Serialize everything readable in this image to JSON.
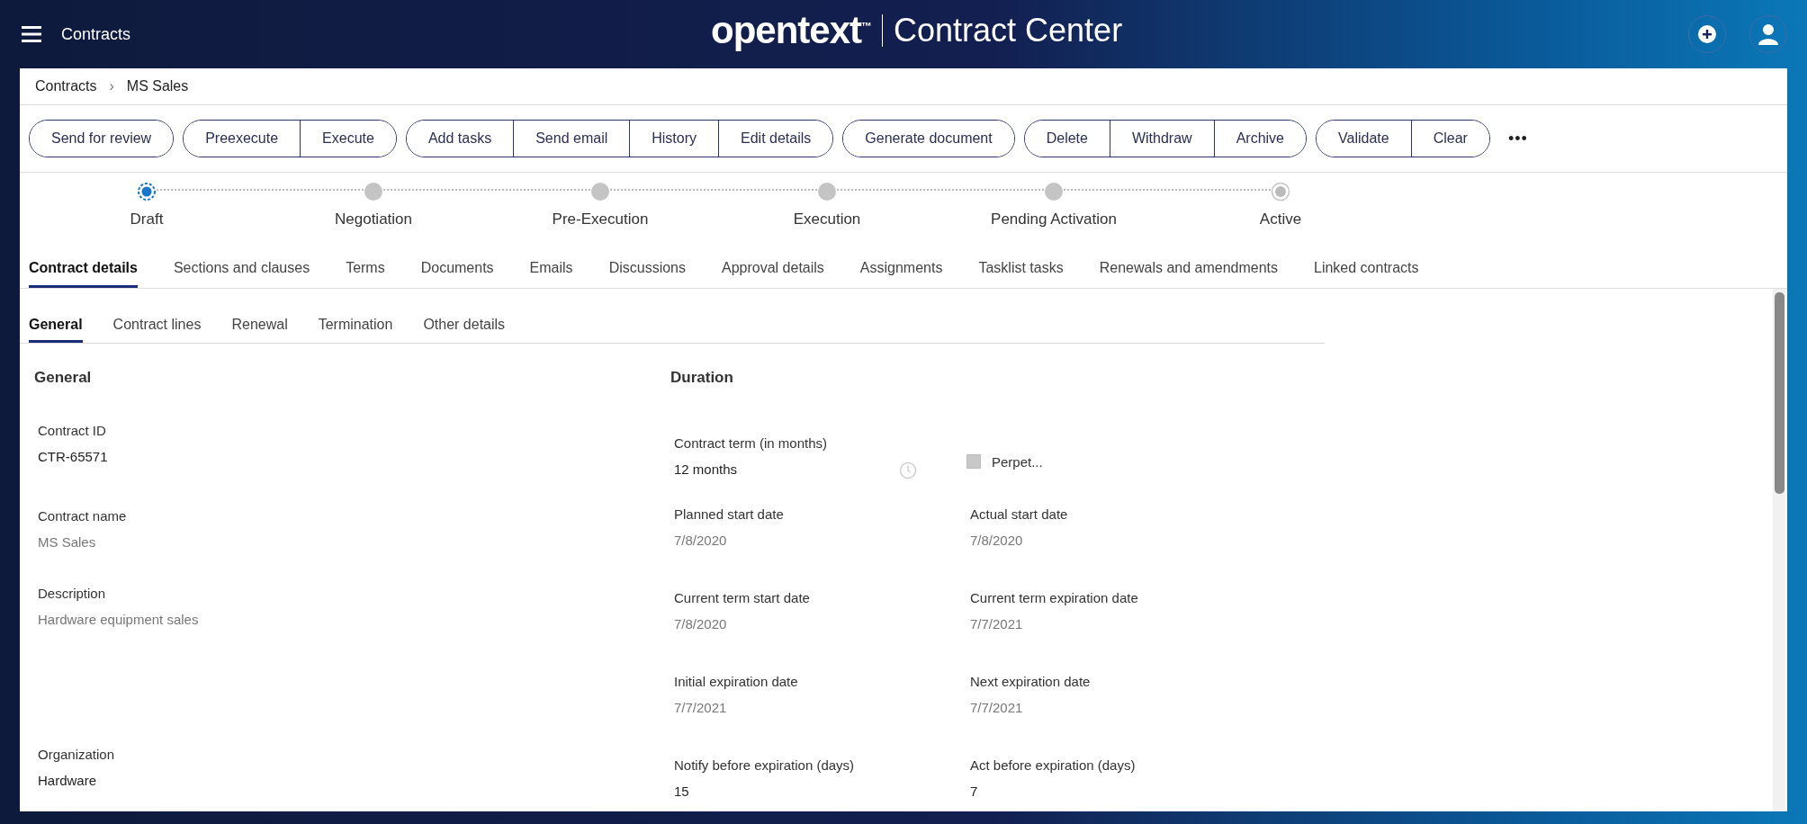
{
  "header": {
    "title": "Contracts",
    "logo": "opentext$^{™}$",
    "product": "Contract Center"
  },
  "breadcrumb": [
    "Contracts",
    "MS Sales"
  ],
  "breadcrumb_separator": "›",
  "toolbar": {
    "groups": [
      [
        "Send for review"
      ],
      [
        "Preexecute",
        "Execute"
      ],
      [
        "Add tasks",
        "Send email",
        "History",
        "Edit details"
      ],
      [
        "Generate document"
      ],
      [
        "Delete",
        "Withdraw",
        "Archive"
      ],
      [
        "Validate",
        "Clear"
      ]
    ],
    "more": "•••"
  },
  "stepper": [
    {
      "label": "Draft",
      "selected": true,
      "kind": "step"
    },
    {
      "label": "Negotiation",
      "selected": false,
      "kind": "step"
    },
    {
      "label": "Pre-Execution",
      "selected": false,
      "kind": "step"
    },
    {
      "label": "Execution",
      "selected": false,
      "kind": "step"
    },
    {
      "label": "Pending Activation",
      "selected": false,
      "kind": "step"
    },
    {
      "label": "Active",
      "selected": false,
      "kind": "end"
    }
  ],
  "tabs": [
    {
      "label": "Contract details",
      "selected": true
    },
    {
      "label": "Sections and clauses",
      "selected": false
    },
    {
      "label": "Terms",
      "selected": false
    },
    {
      "label": "Documents",
      "selected": false
    },
    {
      "label": "Emails",
      "selected": false
    },
    {
      "label": "Discussions",
      "selected": false
    },
    {
      "label": "Approval details",
      "selected": false
    },
    {
      "label": "Assignments",
      "selected": false
    },
    {
      "label": "Tasklist tasks",
      "selected": false
    },
    {
      "label": "Renewals and amendments",
      "selected": false
    },
    {
      "label": "Linked contracts",
      "selected": false
    }
  ],
  "subtabs": [
    {
      "label": "General",
      "selected": true
    },
    {
      "label": "Contract lines",
      "selected": false
    },
    {
      "label": "Renewal",
      "selected": false
    },
    {
      "label": "Termination",
      "selected": false
    },
    {
      "label": "Other details",
      "selected": false
    }
  ],
  "general": {
    "heading": "General",
    "fields": [
      {
        "label": "Contract ID",
        "value": "CTR-65571",
        "disabled": false
      },
      {
        "label": "Contract name",
        "value": "MS Sales",
        "disabled": true
      },
      {
        "label": "Description",
        "value": "Hardware equipment sales",
        "disabled": true
      },
      {
        "label": "Organization",
        "value": "Hardware",
        "disabled": false
      }
    ]
  },
  "duration": {
    "heading": "Duration",
    "rows": [
      [
        {
          "kind": "term",
          "label": "Contract term (in months)",
          "value": "12 months",
          "disabled": false
        },
        {
          "kind": "checkbox",
          "label": "Perpet...",
          "checked": false
        }
      ],
      [
        {
          "kind": "field",
          "label": "Planned start date",
          "value": "7/8/2020",
          "disabled": true
        },
        {
          "kind": "field",
          "label": "Actual start date",
          "value": "7/8/2020",
          "disabled": true
        }
      ],
      [
        {
          "kind": "field",
          "label": "Current term start date",
          "value": "7/8/2020",
          "disabled": true
        },
        {
          "kind": "field",
          "label": "Current term expiration date",
          "value": "7/7/2021",
          "disabled": true
        }
      ],
      [
        {
          "kind": "field",
          "label": "Initial expiration date",
          "value": "7/7/2021",
          "disabled": true
        },
        {
          "kind": "field",
          "label": "Next expiration date",
          "value": "7/7/2021",
          "disabled": true
        }
      ],
      [
        {
          "kind": "field",
          "label": "Notify before expiration (days)",
          "value": "15",
          "disabled": false
        },
        {
          "kind": "field",
          "label": "Act before expiration (days)",
          "value": "7",
          "disabled": false
        }
      ]
    ]
  }
}
